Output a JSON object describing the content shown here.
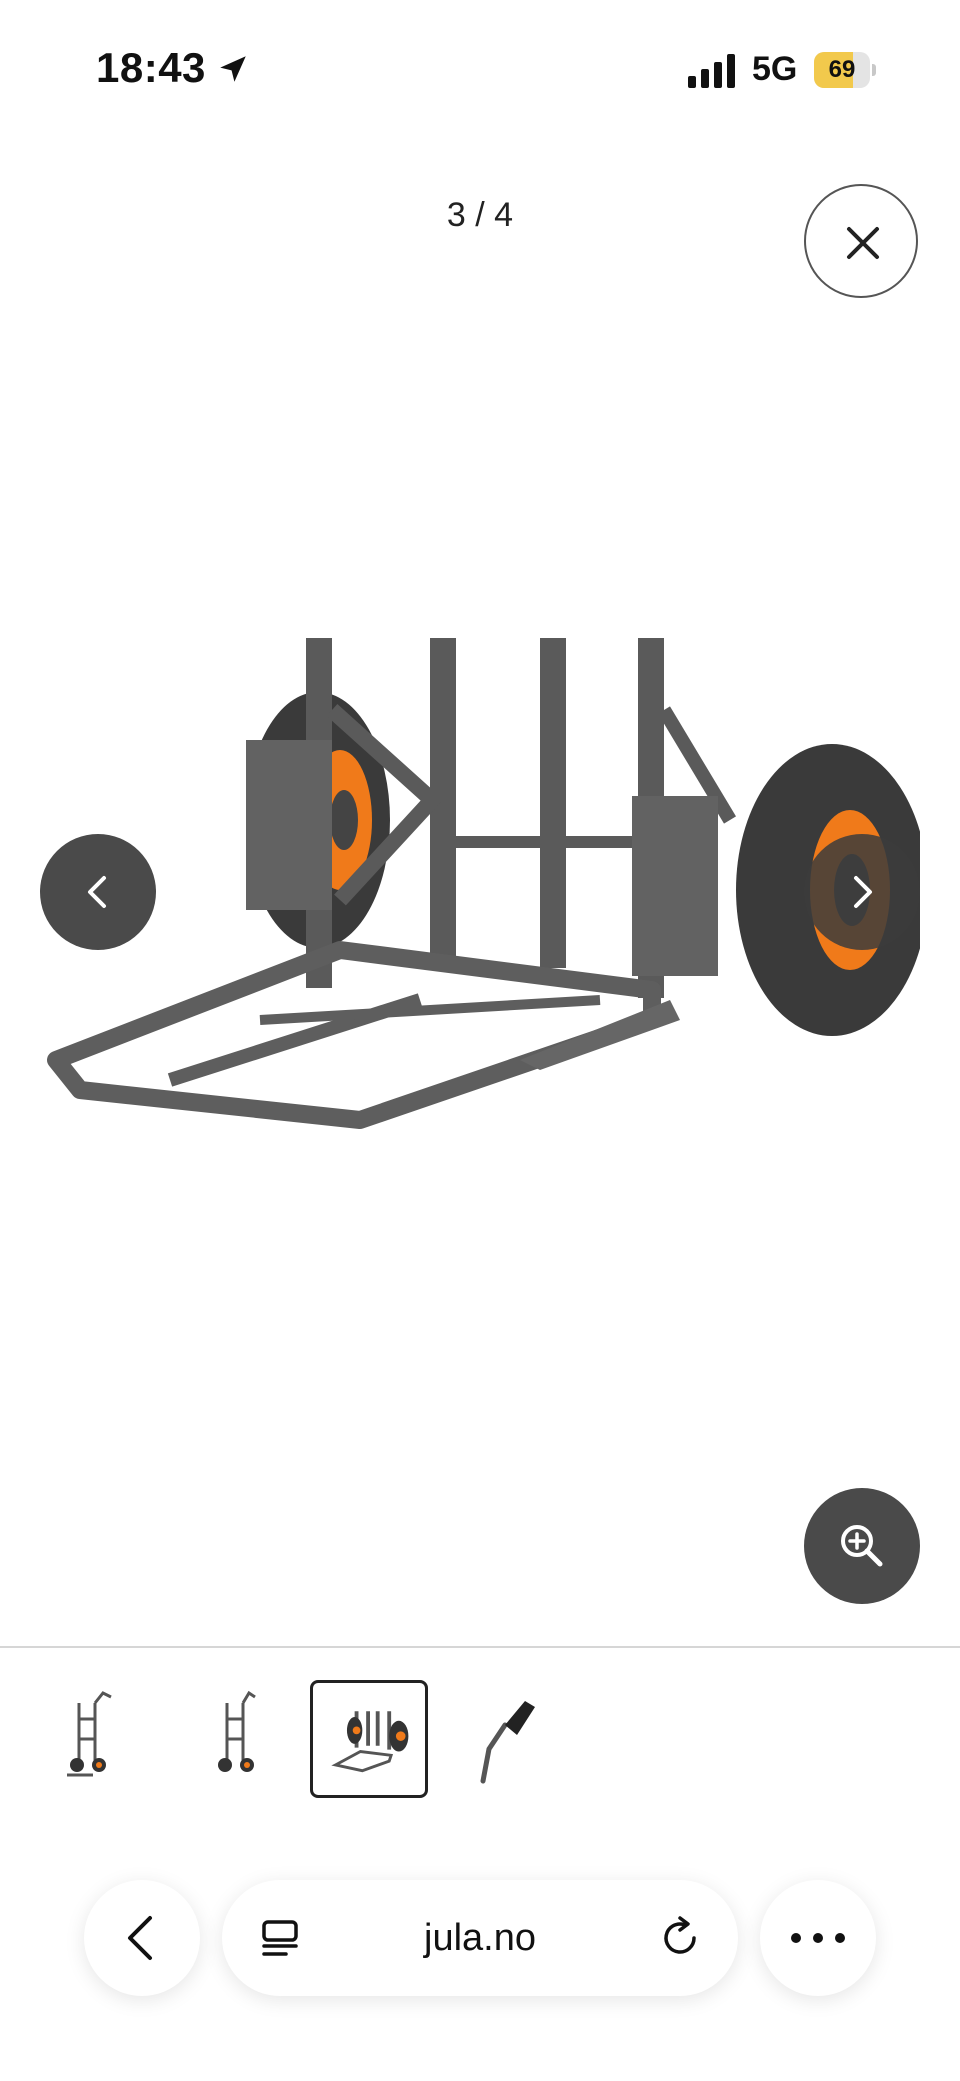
{
  "status_bar": {
    "time": "18:43",
    "network": "5G",
    "battery_level": "69",
    "battery_color": "#f2c94c",
    "icons": [
      "location-arrow-icon",
      "signal-bars-icon",
      "battery-icon"
    ]
  },
  "gallery": {
    "counter": "3 / 4",
    "current_index": 3,
    "total": 4,
    "product_image_icon": "hand-truck-image",
    "accent_color": "#f07a1a",
    "buttons": {
      "close_icon": "close-icon",
      "prev_icon": "chevron-left-icon",
      "next_icon": "chevron-right-icon",
      "zoom_icon": "zoom-in-icon"
    },
    "thumbnails": [
      {
        "icon": "hand-truck-thumbnail",
        "selected": false
      },
      {
        "icon": "hand-truck-thumbnail",
        "selected": false
      },
      {
        "icon": "hand-truck-folded-thumbnail",
        "selected": true
      },
      {
        "icon": "handle-grip-thumbnail",
        "selected": false
      }
    ]
  },
  "browser": {
    "url": "jula.no",
    "icons": [
      "back-icon",
      "tabs-icon",
      "reload-icon",
      "more-icon"
    ]
  }
}
